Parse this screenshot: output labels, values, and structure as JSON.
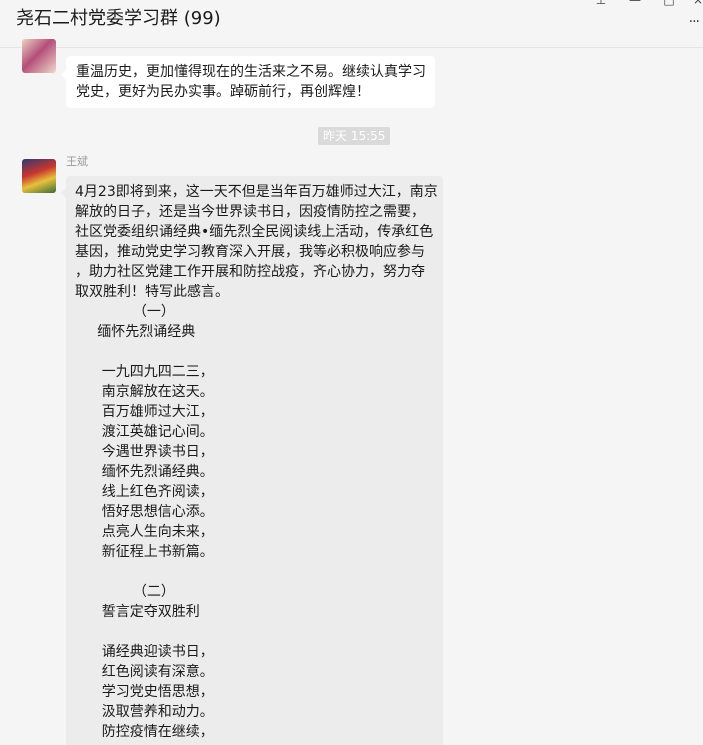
{
  "header": {
    "title": "尧石二村党委学习群 (99)"
  },
  "messages": [
    {
      "text_lines": [
        "重温历史，更加懂得现在的生活来之不易。继续认真学习",
        "党史，更好为民办实事。踔砺前行，再创辉煌！"
      ]
    },
    {
      "timestamp": "昨天 15:55",
      "sender": "王斌",
      "text_lines": [
        "4月23即将到来，这一天不但是当年百万雄师过大江，南京",
        "解放的日子，还是当今世界读书日，因疫情防控之需要，",
        "社区党委组织诵经典•缅先烈全民阅读线上活动，传承红色",
        "基因，推动党史学习教育深入开展，我等必积极响应参与",
        "，助力社区党建工作开展和防控战疫，齐心协力，努力夺",
        "取双胜利！特写此感言。",
        "             （一）",
        "     缅怀先烈诵经典",
        "",
        "      一九四九四二三，",
        "      南京解放在这天。",
        "      百万雄师过大江，",
        "      渡江英雄记心间。",
        "      今遇世界读书日，",
        "      缅怀先烈诵经典。",
        "      线上红色齐阅读，",
        "      悟好思想信心添。",
        "      点亮人生向未来，",
        "      新征程上书新篇。",
        "",
        "             （二）",
        "      誓言定夺双胜利",
        "",
        "      诵经典迎读书日，",
        "      红色阅读有深意。",
        "      学习党史悟思想，",
        "      汲取营养和动力。",
        "      防控疫情在继续，"
      ]
    }
  ]
}
